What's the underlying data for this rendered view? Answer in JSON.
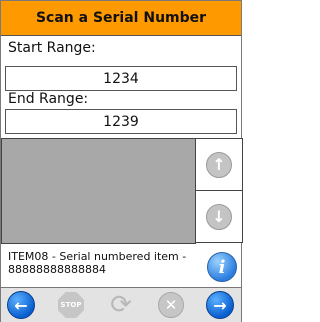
{
  "header": {
    "title": "Scan a Serial Number"
  },
  "form": {
    "start_label": "Start Range:",
    "start_value": "1234",
    "end_label": "End Range:",
    "end_value": "1239"
  },
  "scroll": {
    "up_icon": "arrow-up-icon",
    "down_icon": "arrow-down-icon"
  },
  "item": {
    "description": "ITEM08 - Serial numbered item - 88888888888884",
    "info_glyph": "i"
  },
  "toolbar": {
    "back_icon": "arrow-left-icon",
    "stop_label": "STOP",
    "refresh_icon": "refresh-icon",
    "cancel_icon": "cancel-icon",
    "next_icon": "arrow-right-icon"
  },
  "colors": {
    "title_bar": "#ff9900",
    "list_background": "#a8a8a8",
    "nav_blue": "#0a5fcf",
    "disabled_gray": "#c6c6c6"
  }
}
